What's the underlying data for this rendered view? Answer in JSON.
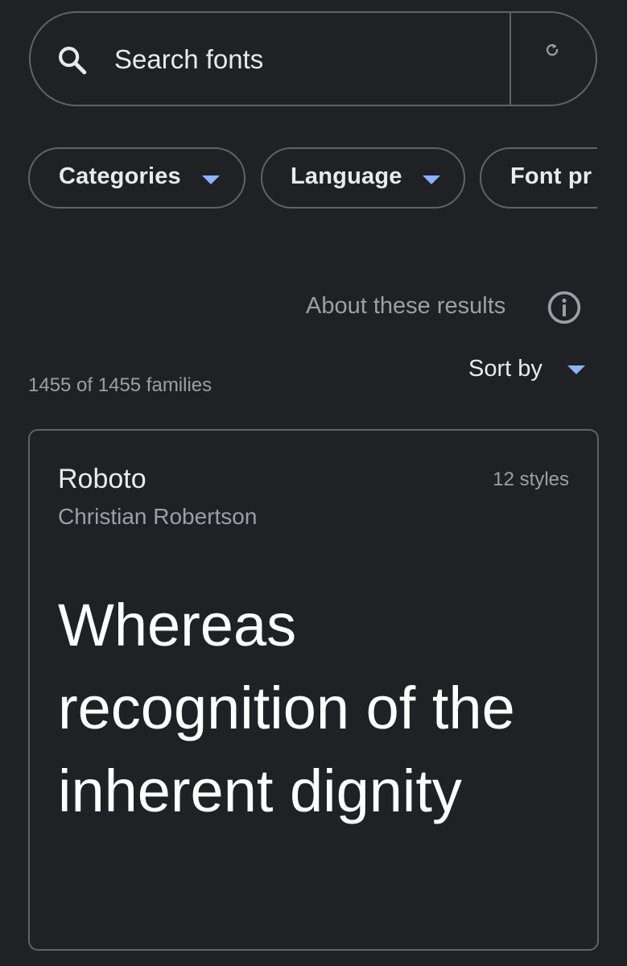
{
  "search": {
    "placeholder": "Search fonts",
    "icon": "search-icon",
    "refresh_icon": "refresh-icon"
  },
  "filters": [
    {
      "label": "Categories",
      "icon": "chevron-down-icon"
    },
    {
      "label": "Language",
      "icon": "chevron-down-icon"
    },
    {
      "label": "Font pr"
    }
  ],
  "about": {
    "label": "About these results",
    "icon": "info-icon"
  },
  "results": {
    "count": "1455 of 1455 families",
    "sort_label": "Sort by"
  },
  "font_card": {
    "name": "Roboto",
    "designer": "Christian Robertson",
    "styles": "12 styles",
    "preview_text": "Whereas recognition of the inherent dignity"
  },
  "colors": {
    "background": "#202124",
    "border": "#5f6368",
    "text": "#e8eaed",
    "muted_text": "#9aa0a6",
    "accent": "#8ab4f8"
  }
}
